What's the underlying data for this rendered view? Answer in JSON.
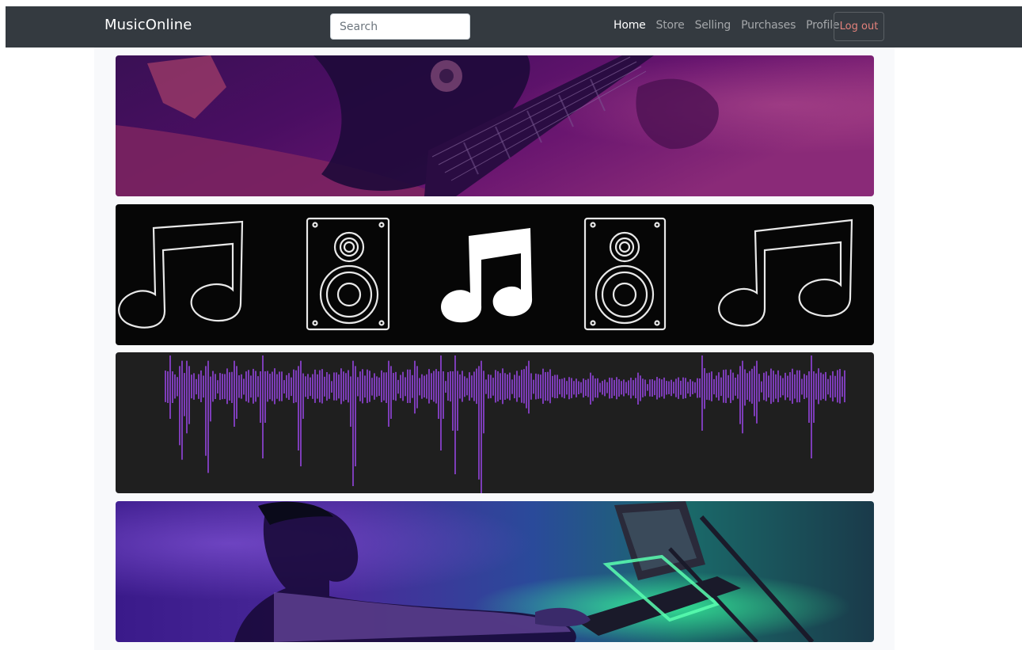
{
  "navbar": {
    "brand": "MusicOnline",
    "search_placeholder": "Search",
    "links": [
      {
        "label": "Home",
        "active": true
      },
      {
        "label": "Store",
        "active": false
      },
      {
        "label": "Selling",
        "active": false
      },
      {
        "label": "Purchases",
        "active": false
      },
      {
        "label": "Profile",
        "active": false
      }
    ],
    "logout_label": "Log out"
  },
  "banners": [
    {
      "subject": "guitar-player-photo"
    },
    {
      "subject": "music-notes-and-speakers-graphic"
    },
    {
      "subject": "audio-waveform-graphic"
    },
    {
      "subject": "dj-with-laptop-photo"
    }
  ],
  "colors": {
    "navbar_bg": "#343a40",
    "active_link": "#ffffff",
    "inactive_link": "#9a9da0",
    "logout_text": "#e4827c",
    "page_bg": "#f8f9fb"
  }
}
